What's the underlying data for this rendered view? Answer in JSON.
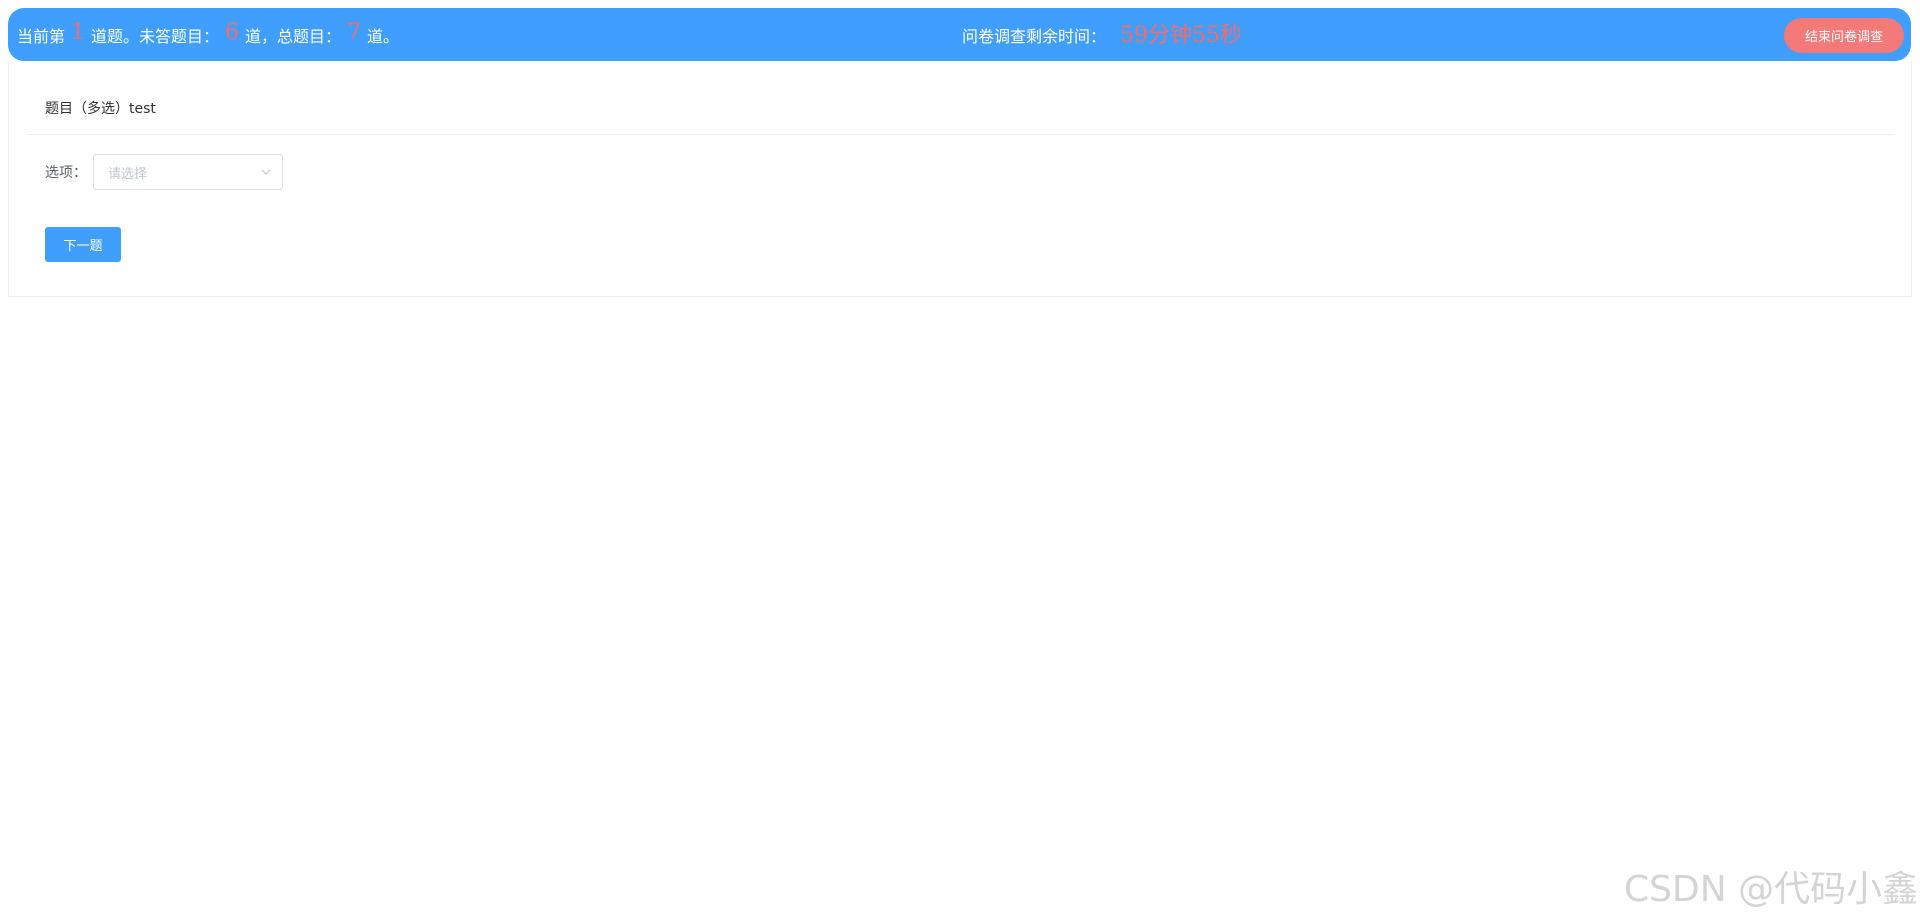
{
  "header": {
    "progress_prefix": "当前第",
    "current_question": "1",
    "progress_mid1": "道题。未答题目：",
    "unanswered": "6",
    "progress_mid2": "道，总题目：",
    "total": "7",
    "progress_suffix": "道。",
    "timer_label": "问卷调查剩余时间：",
    "timer_value": "59分钟55秒",
    "end_button_label": "结束问卷调查"
  },
  "question": {
    "title": "题目（多选）test",
    "options_label": "选项：",
    "select_placeholder": "请选择",
    "next_button_label": "下一题"
  },
  "watermark": "CSDN @代码小鑫",
  "colors": {
    "header_bg": "#409eff",
    "highlight_red": "#f56c6c",
    "end_button_bg": "#f47a7a",
    "primary_button_bg": "#409eff"
  },
  "icons": {
    "select_arrow": "chevron-down-icon"
  }
}
